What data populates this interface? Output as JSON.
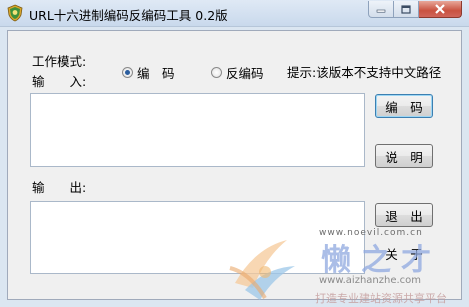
{
  "window": {
    "title": "URL十六进制编码反编码工具 0.2版",
    "icon": "app-shield-icon"
  },
  "form": {
    "mode_label": "工作模式:",
    "input_label": "输　　入:",
    "output_label": "输　　出:",
    "hint": "提示:该版本不支持中文路径",
    "mode_options": [
      {
        "label": "编　码",
        "selected": true
      },
      {
        "label": "反编码",
        "selected": false
      }
    ],
    "input_value": "",
    "output_value": ""
  },
  "buttons": {
    "encode": "编　码",
    "help": "说　明",
    "exit": "退　出",
    "about": "关　于"
  },
  "watermark": {
    "brand": "懒之才",
    "url": "www.aizhanzhe.com",
    "slogan": "打造专业建站资源共享平台",
    "small_url": "www.noevil.com.cn"
  }
}
